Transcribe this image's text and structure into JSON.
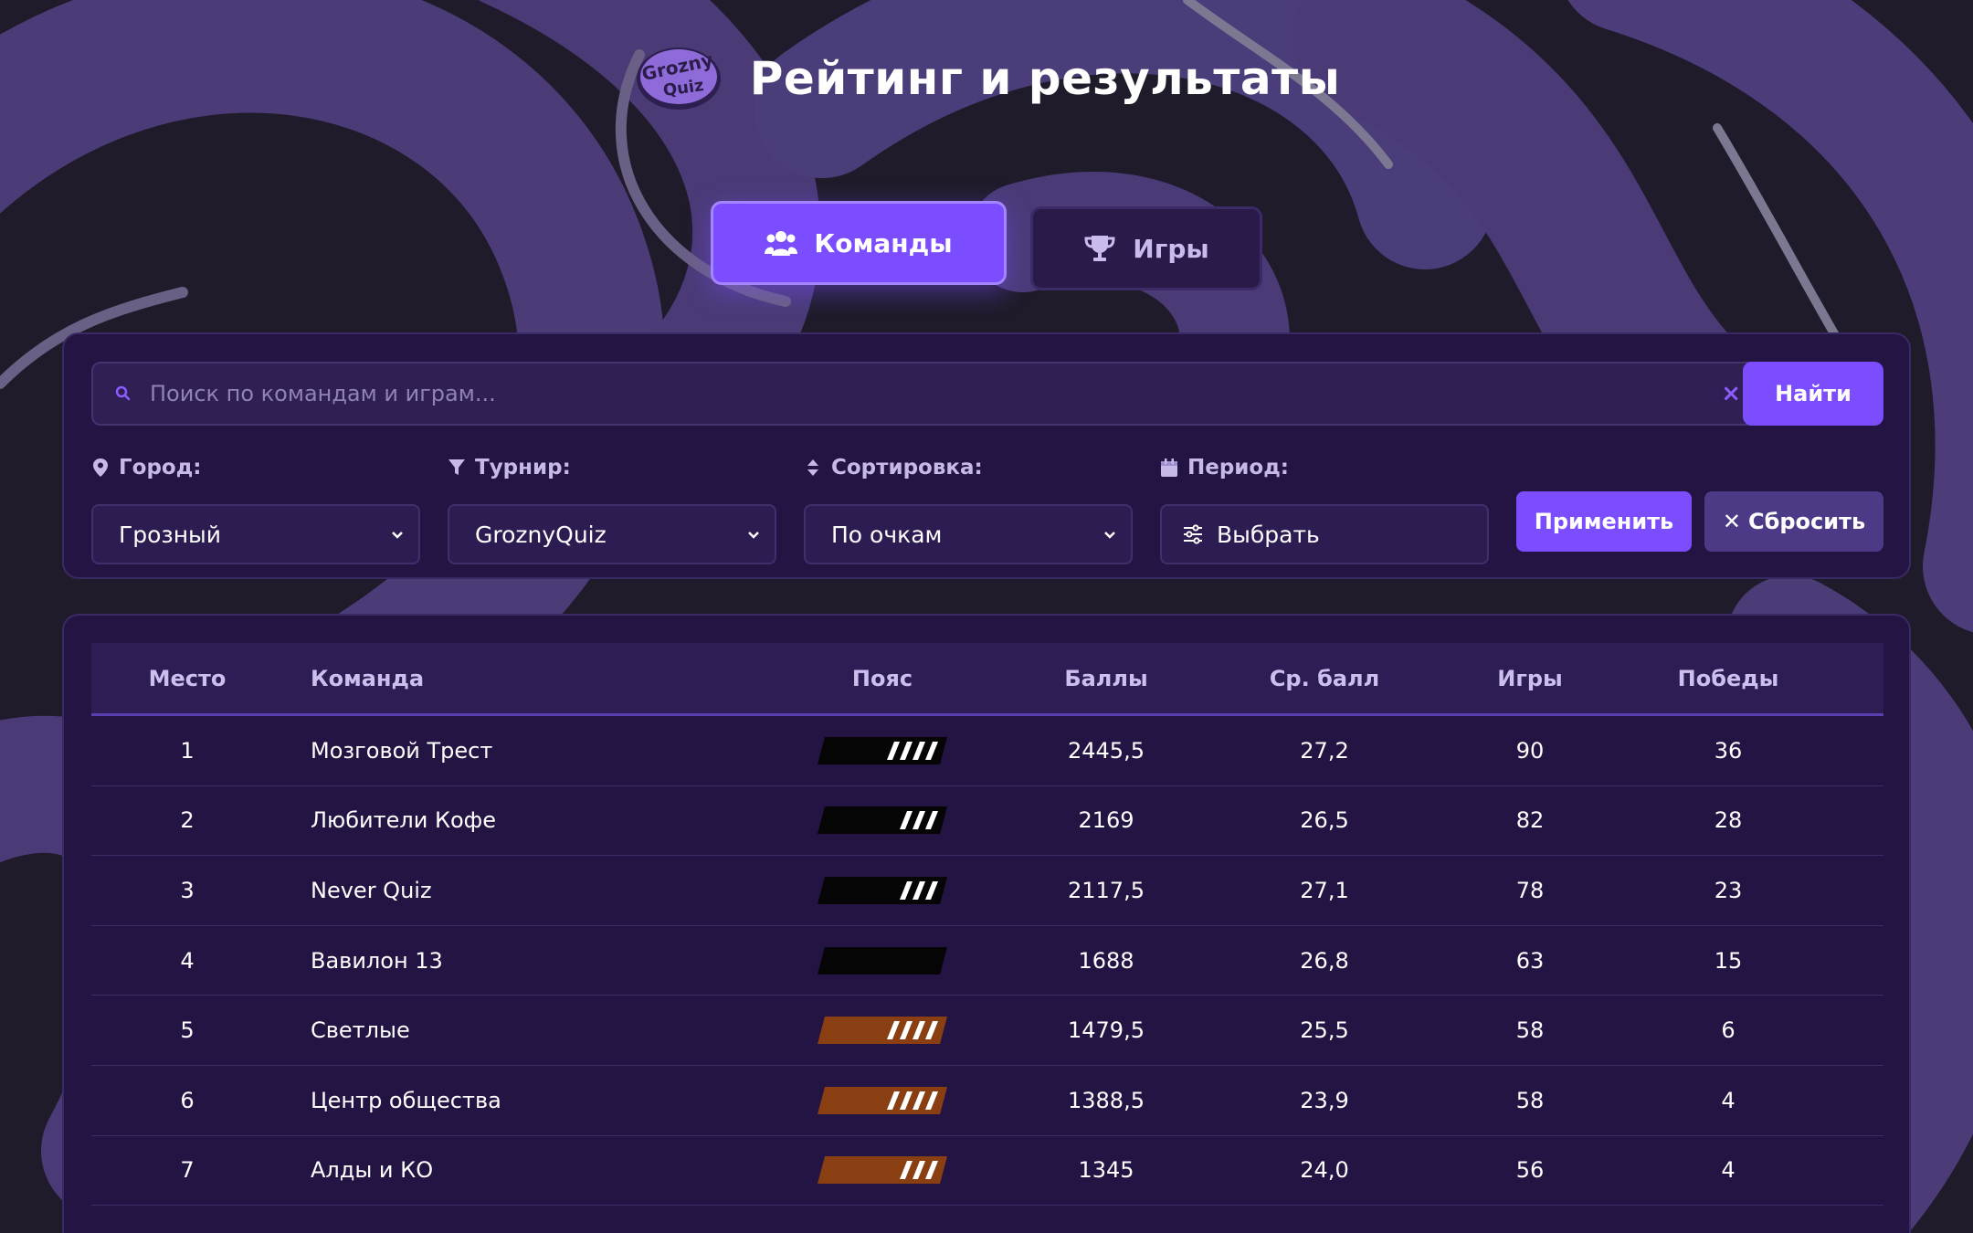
{
  "header": {
    "title": "Рейтинг и результаты",
    "logo_text": "GroznyQuiz",
    "logo_icon": "grozny-quiz-logo"
  },
  "tabs": [
    {
      "label": "Команды",
      "icon": "users-icon",
      "active": true
    },
    {
      "label": "Игры",
      "icon": "trophy-icon",
      "active": false
    }
  ],
  "search": {
    "placeholder": "Поиск по командам и играм...",
    "value": "",
    "button_label": "Найти",
    "clear_icon": "×"
  },
  "filters": {
    "city": {
      "label": "Город:",
      "value": "Грозный",
      "icon": "map-pin-icon"
    },
    "tournament": {
      "label": "Турнир:",
      "value": "GroznyQuiz",
      "icon": "filter-icon"
    },
    "sort": {
      "label": "Сортировка:",
      "value": "По очкам",
      "icon": "sort-icon"
    },
    "period": {
      "label": "Период:",
      "value": "Выбрать",
      "icon": "calendar-icon"
    },
    "apply_label": "Применить",
    "reset_label": "Сбросить",
    "reset_icon": "✕"
  },
  "table": {
    "headers": {
      "place": "Место",
      "team": "Команда",
      "belt": "Пояс",
      "points": "Баллы",
      "avg": "Ср. балл",
      "games": "Игры",
      "wins": "Победы"
    },
    "rows": [
      {
        "place": "1",
        "team": "Мозговой Трест",
        "belt_color": "black",
        "stripes": 4,
        "points": "2445,5",
        "avg": "27,2",
        "games": "90",
        "wins": "36"
      },
      {
        "place": "2",
        "team": "Любители Кофе",
        "belt_color": "black",
        "stripes": 3,
        "points": "2169",
        "avg": "26,5",
        "games": "82",
        "wins": "28"
      },
      {
        "place": "3",
        "team": "Never Quiz",
        "belt_color": "black",
        "stripes": 3,
        "points": "2117,5",
        "avg": "27,1",
        "games": "78",
        "wins": "23"
      },
      {
        "place": "4",
        "team": "Вавилон 13",
        "belt_color": "black",
        "stripes": 0,
        "points": "1688",
        "avg": "26,8",
        "games": "63",
        "wins": "15"
      },
      {
        "place": "5",
        "team": "Светлые",
        "belt_color": "brown",
        "stripes": 4,
        "points": "1479,5",
        "avg": "25,5",
        "games": "58",
        "wins": "6"
      },
      {
        "place": "6",
        "team": "Центр общества",
        "belt_color": "brown",
        "stripes": 4,
        "points": "1388,5",
        "avg": "23,9",
        "games": "58",
        "wins": "4"
      },
      {
        "place": "7",
        "team": "Алды и КО",
        "belt_color": "brown",
        "stripes": 3,
        "points": "1345",
        "avg": "24,0",
        "games": "56",
        "wins": "4"
      }
    ]
  },
  "colors": {
    "accent": "#7b4dff",
    "panel": "#231444",
    "background": "#1f1b2a",
    "belt_black": "#050505",
    "belt_brown": "#8a3f12"
  }
}
